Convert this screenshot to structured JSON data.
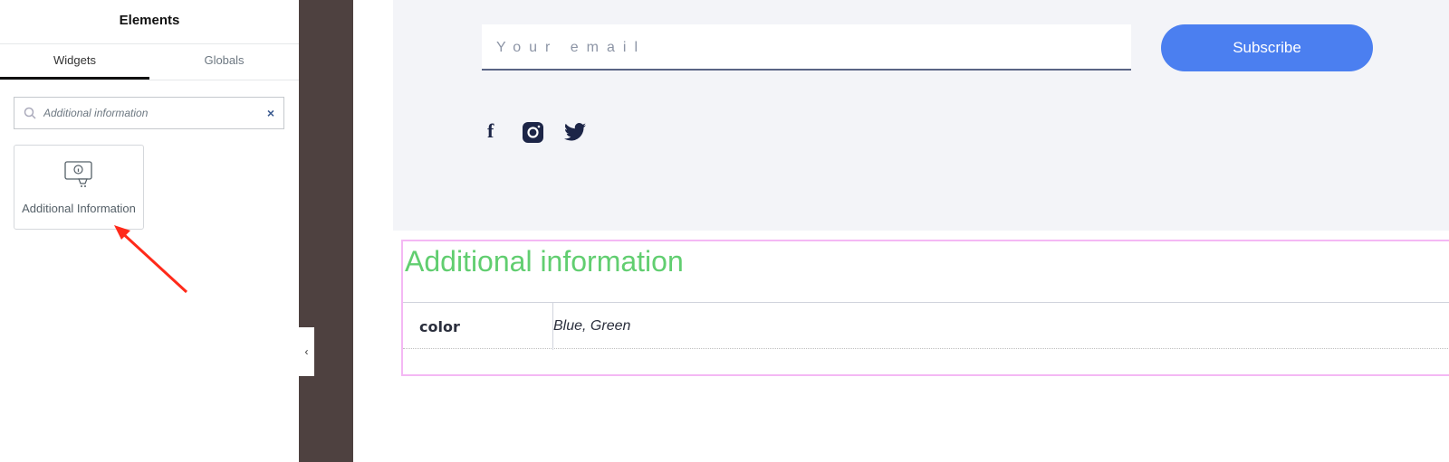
{
  "panel": {
    "title": "Elements",
    "tabs": [
      {
        "label": "Widgets",
        "active": true
      },
      {
        "label": "Globals",
        "active": false
      }
    ],
    "search": {
      "value": "Additional information"
    },
    "widget": {
      "label": "Additional Information",
      "icon": "info-cart-icon"
    }
  },
  "footer": {
    "email_placeholder": "Your email",
    "subscribe_label": "Subscribe",
    "social": [
      "facebook",
      "instagram",
      "twitter"
    ]
  },
  "info": {
    "title": "Additional information",
    "rows": [
      {
        "key": "color",
        "value": "Blue, Green"
      }
    ]
  },
  "colors": {
    "accent": "#4b7ff0",
    "heading": "#61ce70",
    "annotation_arrow": "#ff2a1a"
  }
}
